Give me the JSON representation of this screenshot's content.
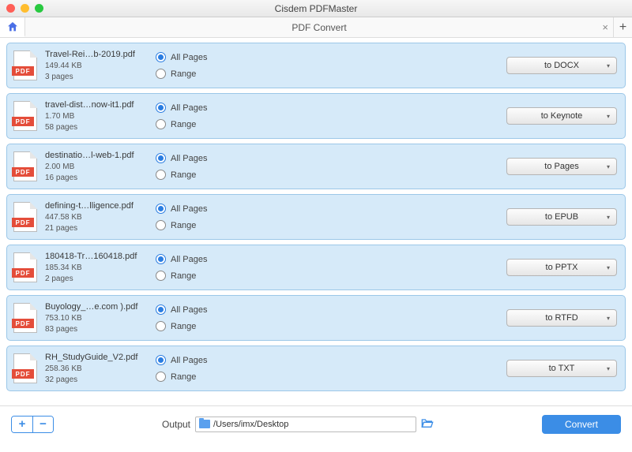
{
  "window": {
    "title": "Cisdem PDFMaster",
    "tab_label": "PDF Convert"
  },
  "files": [
    {
      "name": "Travel-Rei…b-2019.pdf",
      "size": "149.44 KB",
      "pages": "3 pages",
      "all_label": "All Pages",
      "range_label": "Range",
      "format": "to DOCX"
    },
    {
      "name": "travel-dist…now-it1.pdf",
      "size": "1.70 MB",
      "pages": "58 pages",
      "all_label": "All Pages",
      "range_label": "Range",
      "format": "to Keynote"
    },
    {
      "name": "destinatio…l-web-1.pdf",
      "size": "2.00 MB",
      "pages": "16 pages",
      "all_label": "All Pages",
      "range_label": "Range",
      "format": "to Pages"
    },
    {
      "name": "defining-t…lligence.pdf",
      "size": "447.58 KB",
      "pages": "21 pages",
      "all_label": "All Pages",
      "range_label": "Range",
      "format": "to EPUB"
    },
    {
      "name": "180418-Tr…160418.pdf",
      "size": "185.34 KB",
      "pages": "2 pages",
      "all_label": "All Pages",
      "range_label": "Range",
      "format": "to PPTX"
    },
    {
      "name": "Buyology_…e.com ).pdf",
      "size": "753.10 KB",
      "pages": "83 pages",
      "all_label": "All Pages",
      "range_label": "Range",
      "format": "to RTFD"
    },
    {
      "name": "RH_StudyGuide_V2.pdf",
      "size": "258.36 KB",
      "pages": "32 pages",
      "all_label": "All Pages",
      "range_label": "Range",
      "format": "to TXT"
    }
  ],
  "footer": {
    "output_label": "Output",
    "output_path": "/Users/imx/Desktop",
    "convert_label": "Convert"
  },
  "icons": {
    "pdf_band": "PDF"
  }
}
